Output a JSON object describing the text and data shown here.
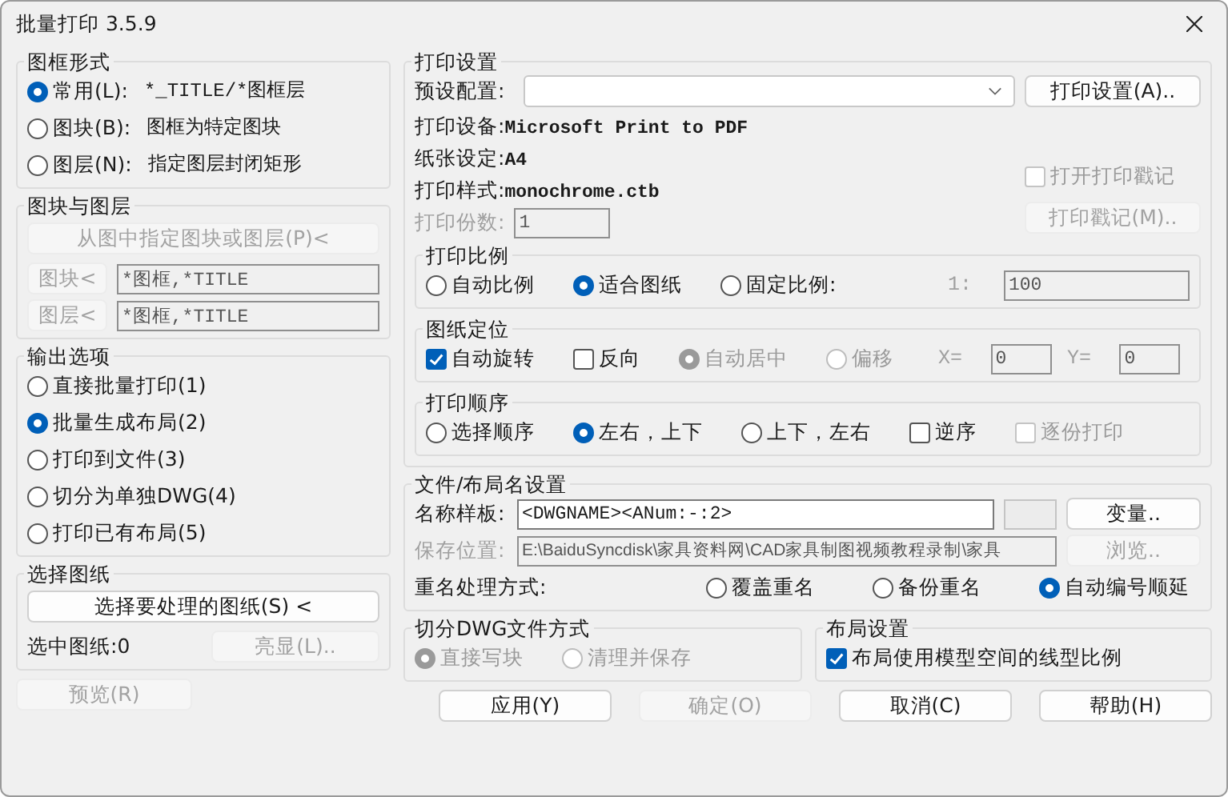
{
  "window": {
    "title": "批量打印 3.5.9"
  },
  "frame_type": {
    "title": "图框形式",
    "options": [
      {
        "label": "常用(L):",
        "desc": "*_TITLE/*图框层",
        "selected": true
      },
      {
        "label": "图块(B):",
        "desc": "图框为特定图块",
        "selected": false
      },
      {
        "label": "图层(N):",
        "desc": "指定图层封闭矩形",
        "selected": false
      }
    ]
  },
  "block_layer": {
    "title": "图块与图层",
    "disabled": true,
    "pick_button": "从图中指定图块或图层(P)<",
    "fields": [
      {
        "button": "图块<",
        "value": "*图框,*TITLE"
      },
      {
        "button": "图层<",
        "value": "*图框,*TITLE"
      }
    ]
  },
  "output": {
    "title": "输出选项",
    "options": [
      {
        "label": "直接批量打印(1)",
        "selected": false
      },
      {
        "label": "批量生成布局(2)",
        "selected": true
      },
      {
        "label": "打印到文件(3)",
        "selected": false
      },
      {
        "label": "切分为单独DWG(4)",
        "selected": false
      },
      {
        "label": "打印已有布局(5)",
        "selected": false
      }
    ]
  },
  "select_drawings": {
    "title": "选择图纸",
    "button": "选择要处理的图纸(S) <",
    "count_label": "选中图纸:0",
    "highlight_button": {
      "label": "亮显(L)..",
      "disabled": true
    }
  },
  "preview_button": {
    "label": "预览(R)",
    "disabled": true
  },
  "print_settings": {
    "title": "打印设置",
    "preset_label": "预设配置:",
    "setup_button": "打印设置(A)..",
    "info": [
      {
        "label": "打印设备:",
        "value": "Microsoft Print to PDF"
      },
      {
        "label": "纸张设定:",
        "value": "A4"
      },
      {
        "label": "打印样式:",
        "value": "monochrome.ctb"
      }
    ],
    "copies": {
      "label": "打印份数:",
      "value": "1",
      "disabled": true
    },
    "stamp_checkbox": {
      "label": "打开打印戳记",
      "checked": false,
      "disabled": true
    },
    "stamp_button": {
      "label": "打印戳记(M)..",
      "disabled": true
    }
  },
  "scale": {
    "title": "打印比例",
    "options": [
      {
        "label": "自动比例",
        "selected": false
      },
      {
        "label": "适合图纸",
        "selected": true
      },
      {
        "label": "固定比例:",
        "selected": false
      }
    ],
    "ratio_prefix": "1:",
    "ratio_value": "100"
  },
  "position": {
    "title": "图纸定位",
    "items": [
      {
        "kind": "checkbox",
        "label": "自动旋转",
        "checked": true,
        "disabled": false
      },
      {
        "kind": "checkbox",
        "label": "反向",
        "checked": false,
        "disabled": false
      },
      {
        "kind": "radio",
        "label": "自动居中",
        "selected": true,
        "disabled": true
      },
      {
        "kind": "radio",
        "label": "偏移",
        "selected": false,
        "disabled": true
      }
    ],
    "offsets": [
      {
        "label": "X=",
        "value": "0"
      },
      {
        "label": "Y=",
        "value": "0"
      }
    ]
  },
  "order": {
    "title": "打印顺序",
    "items": [
      {
        "kind": "radio",
        "label": "选择顺序",
        "selected": false,
        "disabled": false
      },
      {
        "kind": "radio",
        "label": "左右，上下",
        "selected": true,
        "disabled": false
      },
      {
        "kind": "radio",
        "label": "上下，左右",
        "selected": false,
        "disabled": false
      },
      {
        "kind": "checkbox",
        "label": "逆序",
        "checked": false,
        "disabled": false
      },
      {
        "kind": "checkbox",
        "label": "逐份打印",
        "checked": false,
        "disabled": true
      }
    ]
  },
  "file_names": {
    "title": "文件/布局名设置",
    "template_label": "名称样板:",
    "template_value": "<DWGNAME><ANum:-:2>",
    "variables_button": "变量..",
    "save_label": "保存位置:",
    "save_value": "E:\\BaiduSyncdisk\\家具资料网\\CAD家具制图视频教程录制\\家具",
    "browse_button": "浏览..",
    "save_disabled": true,
    "rename_label": "重名处理方式:",
    "rename_options": [
      {
        "label": "覆盖重名",
        "selected": false
      },
      {
        "label": "备份重名",
        "selected": false
      },
      {
        "label": "自动编号顺延",
        "selected": true
      }
    ]
  },
  "split": {
    "title": "切分DWG文件方式",
    "options": [
      {
        "label": "直接写块",
        "selected": true,
        "disabled": true
      },
      {
        "label": "清理并保存",
        "selected": false,
        "disabled": true
      }
    ]
  },
  "layout": {
    "title": "布局设置",
    "checkbox": {
      "label": "布局使用模型空间的线型比例",
      "checked": true
    }
  },
  "buttons": [
    {
      "label": "应用(Y)",
      "disabled": false
    },
    {
      "label": "确定(O)",
      "disabled": true
    },
    {
      "label": "取消(C)",
      "disabled": false
    },
    {
      "label": "帮助(H)",
      "disabled": false
    }
  ]
}
